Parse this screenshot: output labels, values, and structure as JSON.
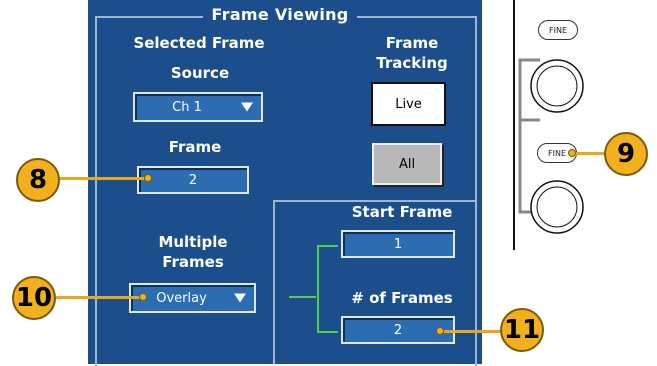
{
  "panel": {
    "title": "Frame Viewing",
    "selected_frame_label": "Selected Frame",
    "source_label": "Source",
    "source_value": "Ch 1",
    "frame_label": "Frame",
    "frame_value": "2",
    "multiple_frames_label_line1": "Multiple",
    "multiple_frames_label_line2": "Frames",
    "multiple_frames_value": "Overlay",
    "frame_tracking_label_line1": "Frame",
    "frame_tracking_label_line2": "Tracking",
    "live_button": "Live",
    "all_button": "All",
    "start_frame_label": "Start Frame",
    "start_frame_value": "1",
    "num_frames_label": "# of Frames",
    "num_frames_value": "2"
  },
  "callouts": {
    "c8": "8",
    "c9": "9",
    "c10": "10",
    "c11": "11"
  },
  "front_panel": {
    "fine_top": "FINE",
    "fine_bottom": "FINE"
  },
  "colors": {
    "panel_bg": "#1b4e8a",
    "field_bg": "#2c6cb0",
    "callout": "#f2b01e",
    "bracket": "#4cd04c"
  }
}
